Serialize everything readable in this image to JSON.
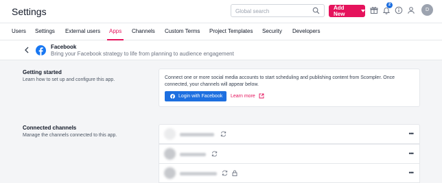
{
  "header": {
    "title": "Settings",
    "search_placeholder": "Global search",
    "add_new_label": "Add New",
    "notification_count": "2",
    "avatar_initial": "D"
  },
  "tabs": [
    {
      "label": "Users"
    },
    {
      "label": "Settings"
    },
    {
      "label": "External users"
    },
    {
      "label": "Apps",
      "active": true
    },
    {
      "label": "Channels"
    },
    {
      "label": "Custom Terms"
    },
    {
      "label": "Project Templates"
    },
    {
      "label": "Security"
    },
    {
      "label": "Developers"
    }
  ],
  "app": {
    "name": "Facebook",
    "description": "Bring your Facebook strategy to life from planning to audience engagement"
  },
  "getting_started": {
    "title": "Getting started",
    "description": "Learn how to set up and configure this app.",
    "card_text": "Connect one or more social media accounts to start scheduling and publishing content from Scompler. Once connected, your channels will appear below.",
    "login_label": "Login with Facebook",
    "learn_more_label": "Learn more"
  },
  "connected_channels": {
    "title": "Connected channels",
    "description": "Manage the channels connected to this app.",
    "more_label": "•••"
  },
  "colors": {
    "accent": "#e5135c",
    "facebook_blue": "#1d6fe0"
  }
}
